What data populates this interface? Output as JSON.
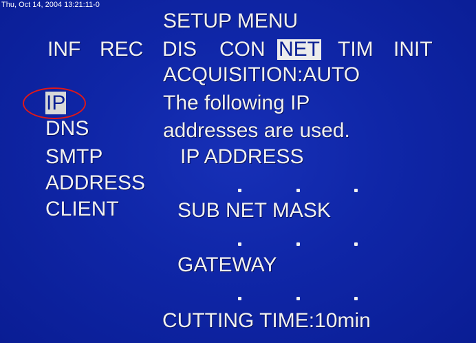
{
  "timestamp": "Thu, Oct 14, 2004 13:21:11-0",
  "title": "SETUP MENU",
  "tabs": [
    {
      "label": "INF",
      "active": false
    },
    {
      "label": "REC",
      "active": false
    },
    {
      "label": "DIS",
      "active": false
    },
    {
      "label": "CON",
      "active": false
    },
    {
      "label": "NET",
      "active": true
    },
    {
      "label": "TIM",
      "active": false
    },
    {
      "label": "INIT",
      "active": false
    }
  ],
  "acquisition": "ACQUISITION:AUTO",
  "menu": [
    {
      "label": "IP",
      "selected": true
    },
    {
      "label": "DNS",
      "selected": false
    },
    {
      "label": "SMTP",
      "selected": false
    },
    {
      "label": "ADDRESS",
      "selected": false
    },
    {
      "label": "CLIENT",
      "selected": false
    }
  ],
  "info_line1": "The following IP",
  "info_line2": "addresses are used.",
  "ip_address_label": "IP ADDRESS",
  "subnet_mask_label": "SUB NET MASK",
  "gateway_label": "GATEWAY",
  "cutting_time": "CUTTING TIME:10min",
  "colors": {
    "background": "#0a1f93",
    "text": "#f1f1f1",
    "highlight_circle": "#e01818"
  }
}
